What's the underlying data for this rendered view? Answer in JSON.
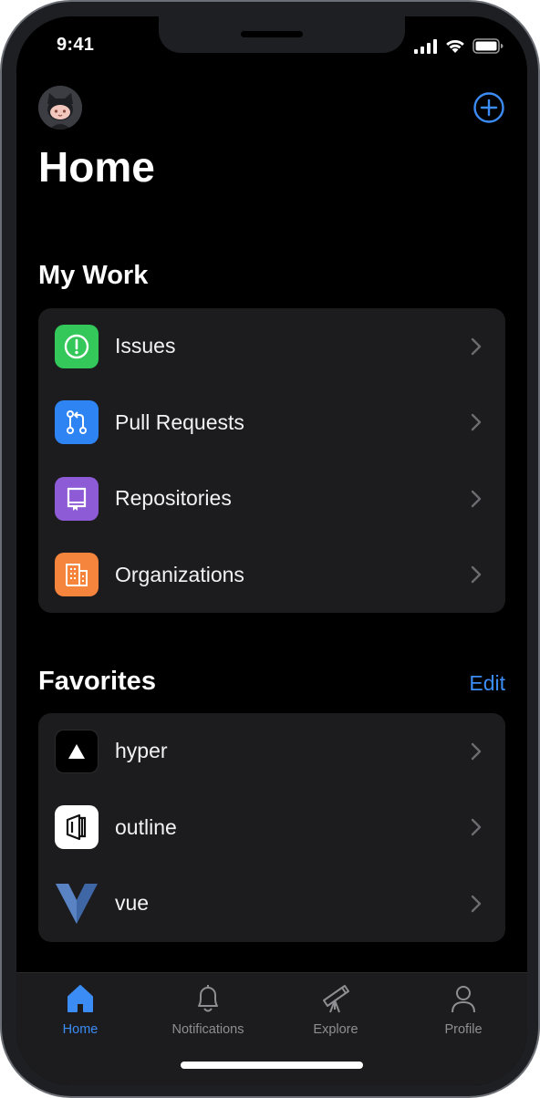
{
  "status_bar": {
    "time": "9:41"
  },
  "header": {
    "title": "Home"
  },
  "my_work": {
    "title": "My Work",
    "items": [
      {
        "label": "Issues",
        "icon": "issue-opened-icon",
        "color": "#34c759"
      },
      {
        "label": "Pull Requests",
        "icon": "git-pull-request-icon",
        "color": "#2f84f4"
      },
      {
        "label": "Repositories",
        "icon": "repo-icon",
        "color": "#8e5bd6"
      },
      {
        "label": "Organizations",
        "icon": "organization-icon",
        "color": "#f5843c"
      }
    ]
  },
  "favorites": {
    "title": "Favorites",
    "edit_label": "Edit",
    "items": [
      {
        "label": "hyper",
        "icon": "hyper-logo-icon"
      },
      {
        "label": "outline",
        "icon": "outline-logo-icon"
      },
      {
        "label": "vue",
        "icon": "vue-logo-icon"
      }
    ]
  },
  "tabbar": {
    "tabs": [
      {
        "label": "Home",
        "icon": "home-icon",
        "active": true
      },
      {
        "label": "Notifications",
        "icon": "bell-icon",
        "active": false
      },
      {
        "label": "Explore",
        "icon": "telescope-icon",
        "active": false
      },
      {
        "label": "Profile",
        "icon": "person-icon",
        "active": false
      }
    ]
  },
  "colors": {
    "accent": "#3b8cf5",
    "background": "#000000",
    "card": "#1c1c1f"
  }
}
